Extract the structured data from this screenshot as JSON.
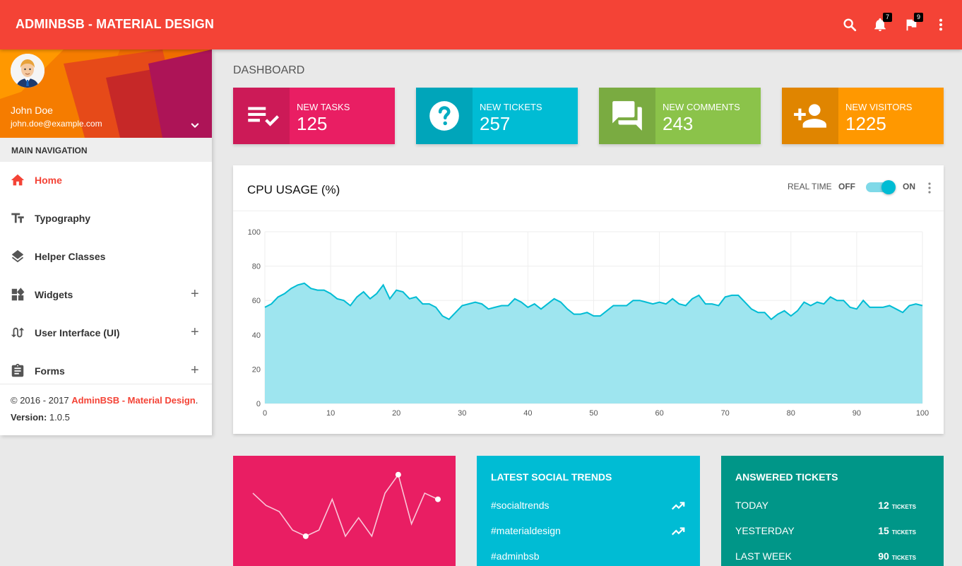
{
  "topbar": {
    "brand": "ADMINBSB - MATERIAL DESIGN",
    "notifications_count": "7",
    "tasks_count": "9",
    "color": "#f44336"
  },
  "user": {
    "name": "John Doe",
    "email": "john.doe@example.com"
  },
  "nav": {
    "header": "MAIN NAVIGATION",
    "items": [
      {
        "label": "Home",
        "icon": "home-icon",
        "active": true,
        "expandable": false
      },
      {
        "label": "Typography",
        "icon": "text-fields-icon",
        "active": false,
        "expandable": false
      },
      {
        "label": "Helper Classes",
        "icon": "layers-icon",
        "active": false,
        "expandable": false
      },
      {
        "label": "Widgets",
        "icon": "widgets-icon",
        "active": false,
        "expandable": true
      },
      {
        "label": "User Interface (UI)",
        "icon": "swap-calls-icon",
        "active": false,
        "expandable": true
      },
      {
        "label": "Forms",
        "icon": "assignment-icon",
        "active": false,
        "expandable": true
      }
    ],
    "plus": "+"
  },
  "legal": {
    "copyright_prefix": "© 2016 - 2017 ",
    "brand": "AdminBSB - Material Design",
    "copyright_suffix": ".",
    "version_label": "Version:",
    "version": " 1.0.5"
  },
  "page": {
    "title": "DASHBOARD"
  },
  "info_boxes": [
    {
      "label": "NEW TASKS",
      "value": "125",
      "color": "#e91e63",
      "icon": "playlist-check-icon"
    },
    {
      "label": "NEW TICKETS",
      "value": "257",
      "color": "#00bcd4",
      "icon": "help-icon"
    },
    {
      "label": "NEW COMMENTS",
      "value": "243",
      "color": "#8bc34a",
      "icon": "forum-icon"
    },
    {
      "label": "NEW VISITORS",
      "value": "1225",
      "color": "#ff9800",
      "icon": "person-add-icon"
    }
  ],
  "cpu": {
    "title": "CPU USAGE (%)",
    "realtime_label": "REAL TIME",
    "off_label": "OFF",
    "on_label": "ON",
    "realtime_on": true
  },
  "chart_data": {
    "type": "area",
    "title": "CPU USAGE (%)",
    "xlabel": "",
    "ylabel": "",
    "xlim": [
      0,
      100
    ],
    "ylim": [
      0,
      100
    ],
    "x_ticks": [
      0,
      10,
      20,
      30,
      40,
      50,
      60,
      70,
      80,
      90,
      100
    ],
    "y_ticks": [
      0,
      20,
      40,
      60,
      80,
      100
    ],
    "grid": true,
    "color": "#00bcd4",
    "fill": "#9ee5ef",
    "x": [
      0,
      1,
      2,
      3,
      4,
      5,
      6,
      7,
      8,
      9,
      10,
      11,
      12,
      13,
      14,
      15,
      16,
      17,
      18,
      19,
      20,
      21,
      22,
      23,
      24,
      25,
      26,
      27,
      28,
      29,
      30,
      31,
      32,
      33,
      34,
      35,
      36,
      37,
      38,
      39,
      40,
      41,
      42,
      43,
      44,
      45,
      46,
      47,
      48,
      49,
      50,
      51,
      52,
      53,
      54,
      55,
      56,
      57,
      58,
      59,
      60,
      61,
      62,
      63,
      64,
      65,
      66,
      67,
      68,
      69,
      70,
      71,
      72,
      73,
      74,
      75,
      76,
      77,
      78,
      79,
      80,
      81,
      82,
      83,
      84,
      85,
      86,
      87,
      88,
      89,
      90,
      91,
      92,
      93,
      94,
      95,
      96,
      97,
      98,
      99,
      100
    ],
    "values": [
      56,
      58,
      62,
      64,
      67,
      69,
      70,
      67,
      66,
      66,
      64,
      61,
      60,
      57,
      62,
      65,
      61,
      64,
      69,
      61,
      66,
      65,
      61,
      62,
      58,
      58,
      56,
      51,
      49,
      53,
      57,
      58,
      59,
      58,
      55,
      56,
      57,
      57,
      61,
      59,
      56,
      58,
      55,
      58,
      61,
      59,
      55,
      52,
      52,
      53,
      51,
      51,
      54,
      57,
      57,
      57,
      60,
      60,
      59,
      58,
      59,
      58,
      61,
      58,
      57,
      61,
      63,
      58,
      58,
      57,
      62,
      63,
      63,
      59,
      55,
      53,
      53,
      49,
      52,
      54,
      51,
      54,
      59,
      57,
      59,
      58,
      62,
      60,
      60,
      56,
      55,
      60,
      56,
      56,
      56,
      57,
      55,
      53,
      57,
      58,
      57
    ]
  },
  "spark_data": {
    "type": "line",
    "values": [
      5,
      4,
      3.5,
      2,
      1.5,
      2,
      4.5,
      1.5,
      3,
      1.5,
      5,
      6.5,
      2.5,
      5,
      4.5
    ],
    "ylim": [
      0,
      7
    ],
    "color": "#ffffff"
  },
  "social": {
    "title": "LATEST SOCIAL TRENDS",
    "items": [
      {
        "label": "#socialtrends"
      },
      {
        "label": "#materialdesign"
      },
      {
        "label": "#adminbsb"
      }
    ]
  },
  "tickets": {
    "title": "ANSWERED TICKETS",
    "unit": "TICKETS",
    "items": [
      {
        "label": "TODAY",
        "value": "12"
      },
      {
        "label": "YESTERDAY",
        "value": "15"
      },
      {
        "label": "LAST WEEK",
        "value": "90"
      }
    ]
  }
}
